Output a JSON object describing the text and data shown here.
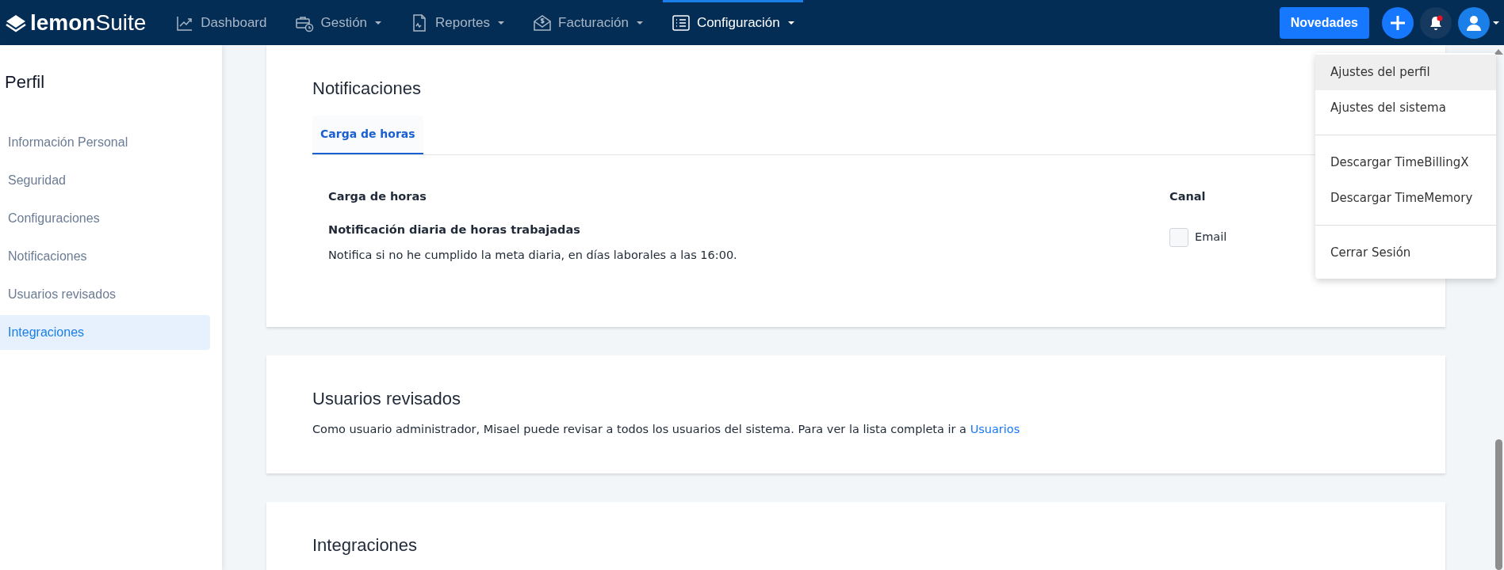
{
  "brand": "**lemon**Suite",
  "nav": [
    {
      "label": "Dashboard",
      "dropdown": false,
      "selected": false
    },
    {
      "label": "Gestión",
      "dropdown": true,
      "selected": false
    },
    {
      "label": "Reportes",
      "dropdown": true,
      "selected": false
    },
    {
      "label": "Facturación",
      "dropdown": true,
      "selected": false
    },
    {
      "label": "Configuración",
      "dropdown": true,
      "selected": true
    }
  ],
  "news_button": "Novedades",
  "notifications": {
    "unread": true
  },
  "user_menu": {
    "groups": [
      {
        "items": [
          {
            "label": "Ajustes del perfil",
            "highlighted": true
          },
          {
            "label": "Ajustes del sistema",
            "highlighted": false
          }
        ]
      },
      {
        "items": [
          {
            "label": "Descargar TimeBillingX",
            "highlighted": false
          },
          {
            "label": "Descargar TimeMemory",
            "highlighted": false
          }
        ]
      },
      {
        "items": [
          {
            "label": "Cerrar Sesión",
            "highlighted": false
          }
        ]
      }
    ]
  },
  "sidebar": {
    "title": "Perfil",
    "items": [
      {
        "label": "Información Personal",
        "selected": false
      },
      {
        "label": "Seguridad",
        "selected": false
      },
      {
        "label": "Configuraciones",
        "selected": false
      },
      {
        "label": "Notificaciones",
        "selected": false
      },
      {
        "label": "Usuarios revisados",
        "selected": false
      },
      {
        "label": "Integraciones",
        "selected": true
      }
    ]
  },
  "notifications_card": {
    "title": "Notificaciones",
    "tabs": [
      {
        "label": "Carga de horas",
        "selected": true
      }
    ],
    "columns": [
      "Carga de horas",
      "Canal"
    ],
    "rows": [
      {
        "title": "Notificación diaria de horas trabajadas",
        "description": "Notifica si no he cumplido la meta diaria, en días laborales a las 16:00.",
        "channel": {
          "label": "Email",
          "checked": false
        }
      }
    ]
  },
  "reviewed_card": {
    "title": "Usuarios revisados",
    "text": "Como usuario administrador, Misael puede revisar a todos los usuarios del sistema. Para ver la lista completa ir a",
    "link": "Usuarios"
  },
  "integrations_card": {
    "title": "Integraciones"
  }
}
